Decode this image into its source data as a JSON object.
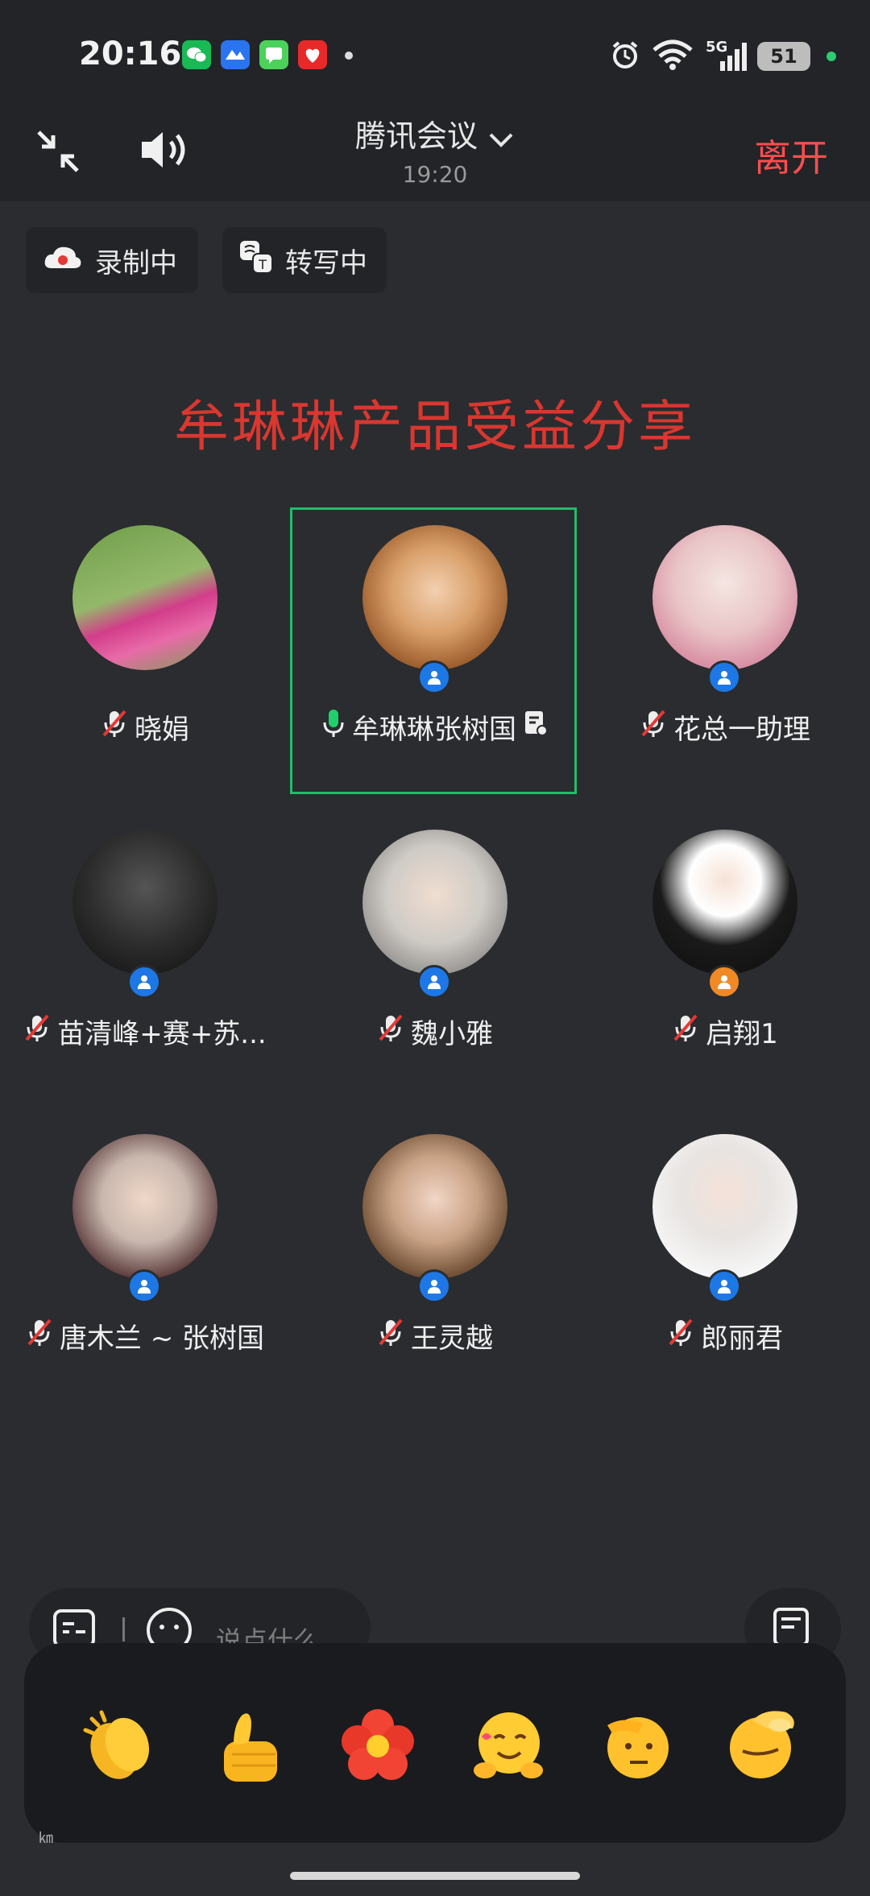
{
  "status_bar": {
    "time": "20:16",
    "network": "5G",
    "battery": "51",
    "icons": [
      "wechat-icon",
      "feishu-icon",
      "messages-icon",
      "app-red-icon",
      "alarm-icon",
      "wifi-icon",
      "signal-icon"
    ]
  },
  "header": {
    "title": "腾讯会议",
    "elapsed": "19:20",
    "leave_label": "离开"
  },
  "status_pills": {
    "recording": "录制中",
    "transcribing": "转写中"
  },
  "share_title": "牟琳琳产品受益分享",
  "participants": [
    {
      "name": "晓娟",
      "mic": "muted",
      "badge": "none"
    },
    {
      "name": "牟琳琳张树国",
      "mic": "on",
      "badge": "blue",
      "active_speaker": true
    },
    {
      "name": "花总一助理",
      "mic": "muted",
      "badge": "blue"
    },
    {
      "name": "苗清峰+赛+苏...",
      "mic": "muted",
      "badge": "blue"
    },
    {
      "name": "魏小雅",
      "mic": "muted",
      "badge": "blue"
    },
    {
      "name": "启翔1",
      "mic": "muted",
      "badge": "orange"
    },
    {
      "name": "唐木兰 ~ 张树国",
      "mic": "muted",
      "badge": "blue"
    },
    {
      "name": "王灵越",
      "mic": "muted",
      "badge": "blue"
    },
    {
      "name": "郎丽君",
      "mic": "muted",
      "badge": "blue"
    }
  ],
  "chat_input": {
    "placeholder": "说点什么"
  },
  "reactions": [
    "clapping-hands-emoji",
    "thumbs-up-emoji",
    "red-flower-emoji",
    "hugging-face-emoji",
    "saluting-face-emoji",
    "face-palm-emoji"
  ],
  "corner_mark": "㎞"
}
